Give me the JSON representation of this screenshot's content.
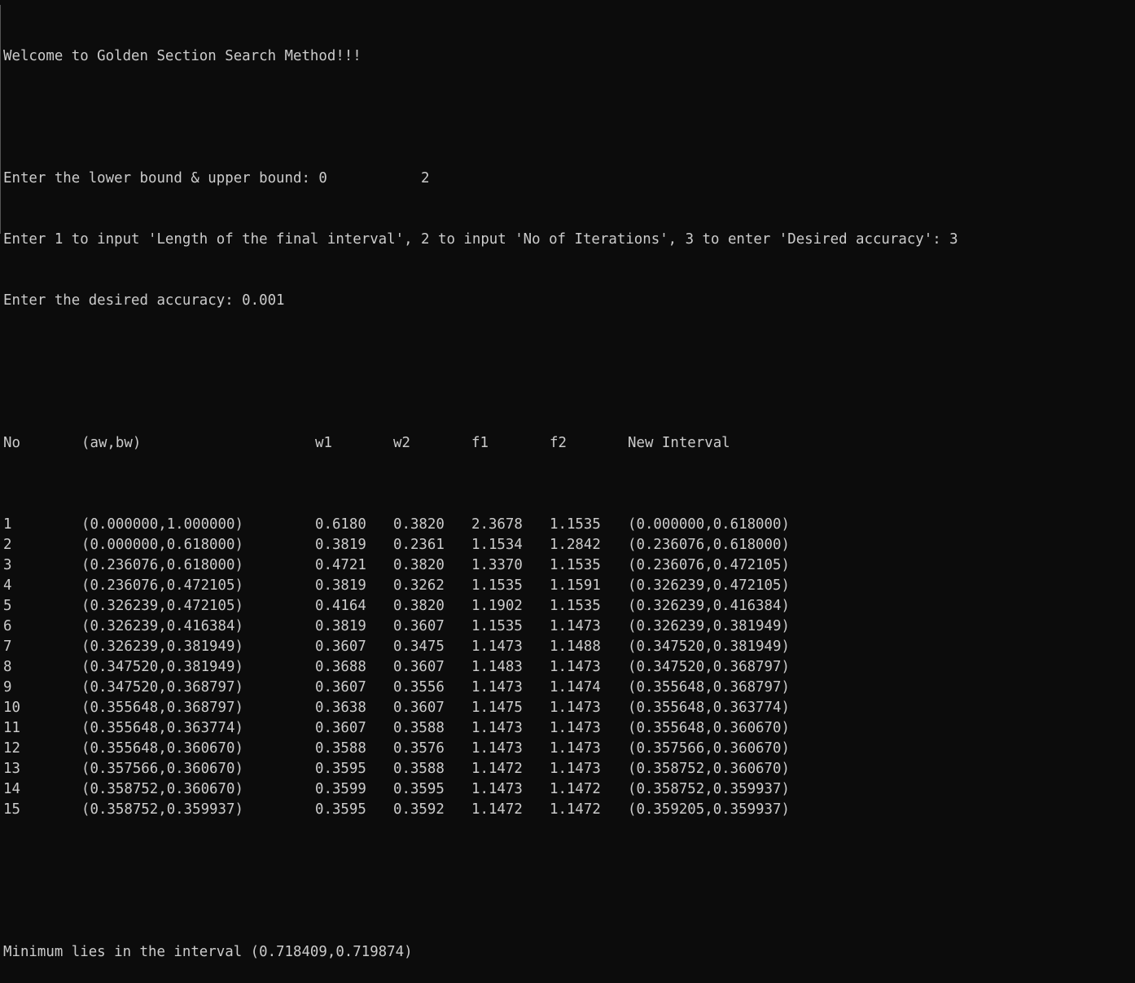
{
  "console": {
    "welcome": "Welcome to Golden Section Search Method!!!",
    "prompt_bounds": "Enter the lower bound & upper bound: 0           2",
    "prompt_choice": "Enter 1 to input 'Length of the final interval', 2 to input 'No of Iterations', 3 to enter 'Desired accuracy': 3",
    "prompt_accuracy": "Enter the desired accuracy: 0.001",
    "table_headers": [
      "No",
      "(aw,bw)",
      "w1",
      "w2",
      "f1",
      "f2",
      "New Interval"
    ],
    "rows": [
      {
        "no": "1",
        "interval": "(0.000000,1.000000)",
        "w1": "0.6180",
        "w2": "0.3820",
        "f1": "2.3678",
        "f2": "1.1535",
        "new_interval": "(0.000000,0.618000)"
      },
      {
        "no": "2",
        "interval": "(0.000000,0.618000)",
        "w1": "0.3819",
        "w2": "0.2361",
        "f1": "1.1534",
        "f2": "1.2842",
        "new_interval": "(0.236076,0.618000)"
      },
      {
        "no": "3",
        "interval": "(0.236076,0.618000)",
        "w1": "0.4721",
        "w2": "0.3820",
        "f1": "1.3370",
        "f2": "1.1535",
        "new_interval": "(0.236076,0.472105)"
      },
      {
        "no": "4",
        "interval": "(0.236076,0.472105)",
        "w1": "0.3819",
        "w2": "0.3262",
        "f1": "1.1535",
        "f2": "1.1591",
        "new_interval": "(0.326239,0.472105)"
      },
      {
        "no": "5",
        "interval": "(0.326239,0.472105)",
        "w1": "0.4164",
        "w2": "0.3820",
        "f1": "1.1902",
        "f2": "1.1535",
        "new_interval": "(0.326239,0.416384)"
      },
      {
        "no": "6",
        "interval": "(0.326239,0.416384)",
        "w1": "0.3819",
        "w2": "0.3607",
        "f1": "1.1535",
        "f2": "1.1473",
        "new_interval": "(0.326239,0.381949)"
      },
      {
        "no": "7",
        "interval": "(0.326239,0.381949)",
        "w1": "0.3607",
        "w2": "0.3475",
        "f1": "1.1473",
        "f2": "1.1488",
        "new_interval": "(0.347520,0.381949)"
      },
      {
        "no": "8",
        "interval": "(0.347520,0.381949)",
        "w1": "0.3688",
        "w2": "0.3607",
        "f1": "1.1483",
        "f2": "1.1473",
        "new_interval": "(0.347520,0.368797)"
      },
      {
        "no": "9",
        "interval": "(0.347520,0.368797)",
        "w1": "0.3607",
        "w2": "0.3556",
        "f1": "1.1473",
        "f2": "1.1474",
        "new_interval": "(0.355648,0.368797)"
      },
      {
        "no": "10",
        "interval": "(0.355648,0.368797)",
        "w1": "0.3638",
        "w2": "0.3607",
        "f1": "1.1475",
        "f2": "1.1473",
        "new_interval": "(0.355648,0.363774)"
      },
      {
        "no": "11",
        "interval": "(0.355648,0.363774)",
        "w1": "0.3607",
        "w2": "0.3588",
        "f1": "1.1473",
        "f2": "1.1473",
        "new_interval": "(0.355648,0.360670)"
      },
      {
        "no": "12",
        "interval": "(0.355648,0.360670)",
        "w1": "0.3588",
        "w2": "0.3576",
        "f1": "1.1473",
        "f2": "1.1473",
        "new_interval": "(0.357566,0.360670)"
      },
      {
        "no": "13",
        "interval": "(0.357566,0.360670)",
        "w1": "0.3595",
        "w2": "0.3588",
        "f1": "1.1472",
        "f2": "1.1473",
        "new_interval": "(0.358752,0.360670)"
      },
      {
        "no": "14",
        "interval": "(0.358752,0.360670)",
        "w1": "0.3599",
        "w2": "0.3595",
        "f1": "1.1473",
        "f2": "1.1472",
        "new_interval": "(0.358752,0.359937)"
      },
      {
        "no": "15",
        "interval": "(0.358752,0.359937)",
        "w1": "0.3595",
        "w2": "0.3592",
        "f1": "1.1472",
        "f2": "1.1472",
        "new_interval": "(0.359205,0.359937)"
      }
    ],
    "result": "Minimum lies in the interval (0.718409,0.719874)"
  },
  "colors": {
    "background": "#0c0c0c",
    "text": "#cccccc"
  }
}
